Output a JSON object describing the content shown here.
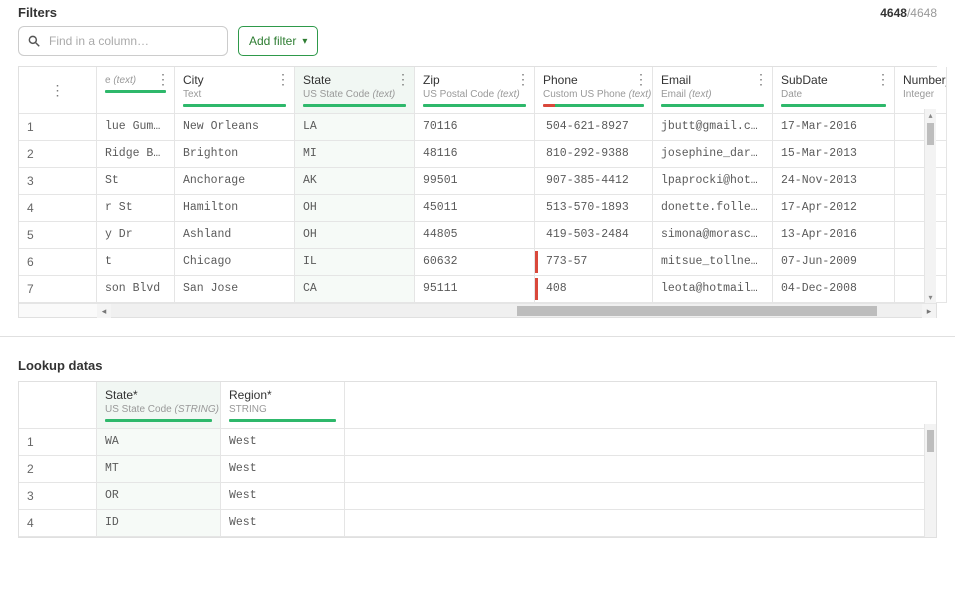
{
  "filters": {
    "label": "Filters",
    "search_placeholder": "Find in a column…",
    "add_filter_label": "Add filter",
    "count_shown": "4648",
    "count_total": "4648"
  },
  "main_table": {
    "columns": [
      {
        "title": "",
        "sub": "e ",
        "sub_italic": "(text)",
        "bar": "ok",
        "kebab": true,
        "state": false,
        "col_key": "address"
      },
      {
        "title": "City",
        "sub": "Text",
        "sub_italic": "",
        "bar": "ok",
        "kebab": true,
        "state": false,
        "col_key": "city"
      },
      {
        "title": "State",
        "sub": "US State Code ",
        "sub_italic": "(text)",
        "bar": "ok",
        "kebab": true,
        "state": true,
        "col_key": "state"
      },
      {
        "title": "Zip",
        "sub": "US Postal Code ",
        "sub_italic": "(text)",
        "bar": "ok",
        "kebab": true,
        "state": false,
        "col_key": "zip"
      },
      {
        "title": "Phone",
        "sub": "Custom US Phone ",
        "sub_italic": "(text)",
        "bar": "warn",
        "kebab": true,
        "state": false,
        "col_key": "phone"
      },
      {
        "title": "Email",
        "sub": "Email ",
        "sub_italic": "(text)",
        "bar": "ok",
        "kebab": true,
        "state": false,
        "col_key": "email"
      },
      {
        "title": "SubDate",
        "sub": "Date",
        "sub_italic": "",
        "bar": "ok",
        "kebab": true,
        "state": false,
        "col_key": "subdate"
      },
      {
        "title": "Number_of",
        "sub": "Integer",
        "sub_italic": "",
        "bar": null,
        "kebab": false,
        "state": false,
        "col_key": "number_of"
      }
    ],
    "rows": [
      {
        "n": "1",
        "address": "lue Gum St",
        "city": "New Orleans",
        "state": "LA",
        "zip": "70116",
        "phone": "504-621-8927",
        "phone_err": false,
        "email": "jbutt@gmail.com",
        "subdate": "17-Mar-2016",
        "number_of": ""
      },
      {
        "n": "2",
        "address": "Ridge Blvd",
        "city": "Brighton",
        "state": "MI",
        "zip": "48116",
        "phone": "810-292-9388",
        "phone_err": false,
        "email": "josephine_darakjy@…",
        "subdate": "15-Mar-2013",
        "number_of": ""
      },
      {
        "n": "3",
        "address": "St",
        "city": "Anchorage",
        "state": "AK",
        "zip": "99501",
        "phone": "907-385-4412",
        "phone_err": false,
        "email": "lpaprocki@hotmail.…",
        "subdate": "24-Nov-2013",
        "number_of": ""
      },
      {
        "n": "4",
        "address": "r St",
        "city": "Hamilton",
        "state": "OH",
        "zip": "45011",
        "phone": "513-570-1893",
        "phone_err": false,
        "email": "donette.foller@cox…",
        "subdate": "17-Apr-2012",
        "number_of": ""
      },
      {
        "n": "5",
        "address": "y Dr",
        "city": "Ashland",
        "state": "OH",
        "zip": "44805",
        "phone": "419-503-2484",
        "phone_err": false,
        "email": "simona@morasca.com",
        "subdate": "13-Apr-2016",
        "number_of": ""
      },
      {
        "n": "6",
        "address": "t",
        "city": "Chicago",
        "state": "IL",
        "zip": "60632",
        "phone": "773-57",
        "phone_err": true,
        "email": "mitsue_tollner@yah…",
        "subdate": "07-Jun-2009",
        "number_of": ""
      },
      {
        "n": "7",
        "address": "son Blvd",
        "city": "San Jose",
        "state": "CA",
        "zip": "95111",
        "phone": "408",
        "phone_err": true,
        "email": "leota@hotmail.com",
        "subdate": "04-Dec-2008",
        "number_of": ""
      }
    ],
    "hscroll_thumb": {
      "left_pct": 50,
      "width_pct": 43
    }
  },
  "lookup": {
    "heading": "Lookup datas",
    "columns": [
      {
        "title": "State*",
        "sub": "US State Code ",
        "sub_italic": "(STRING)",
        "state": true
      },
      {
        "title": "Region*",
        "sub": "STRING",
        "sub_italic": "",
        "state": false
      }
    ],
    "rows": [
      {
        "n": "1",
        "state_v": "WA",
        "region": "West"
      },
      {
        "n": "2",
        "state_v": "MT",
        "region": "West"
      },
      {
        "n": "3",
        "state_v": "OR",
        "region": "West"
      },
      {
        "n": "4",
        "state_v": "ID",
        "region": "West"
      }
    ]
  },
  "icons": {
    "kebab": "⋮",
    "chevron_down": "▾",
    "tri_left": "◂",
    "tri_right": "▸",
    "tri_up": "▴",
    "tri_down": "▾"
  }
}
